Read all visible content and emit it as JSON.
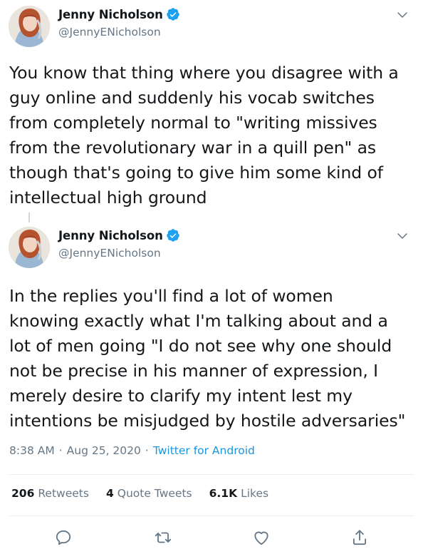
{
  "tweets": [
    {
      "author": {
        "name": "Jenny Nicholson",
        "handle": "@JennyENicholson",
        "verified": true
      },
      "text": "You know that thing where you disagree with a\nguy online and suddenly his vocab switches\nfrom completely normal to \"writing missives\nfrom the revolutionary war in a quill pen\" as\nthough that's going to give him some kind of\nintellectual high ground"
    },
    {
      "author": {
        "name": "Jenny Nicholson",
        "handle": "@JennyENicholson",
        "verified": true
      },
      "text": "In the replies you'll find a lot of women\nknowing exactly what I'm talking about and a\nlot of men going \"I do not see why one should\nnot be precise in his manner of expression, I\nmerely desire to clarify my intent lest my\nintentions be misjudged by hostile adversaries\"",
      "time": "8:38 AM",
      "date": "Aug 25, 2020",
      "separator": "·",
      "source": "Twitter for Android",
      "stats": {
        "retweets": {
          "count": "206",
          "label": "Retweets"
        },
        "quote_tweets": {
          "count": "4",
          "label": "Quote Tweets"
        },
        "likes": {
          "count": "6.1K",
          "label": "Likes"
        }
      }
    }
  ],
  "icons": {
    "verified": "verified-badge-icon",
    "more": "chevron-down-icon",
    "reply": "reply-icon",
    "retweet": "retweet-icon",
    "like": "heart-icon",
    "share": "share-icon"
  },
  "colors": {
    "text": "#14171a",
    "secondary": "#657786",
    "link": "#1b95e0",
    "verified": "#1da1f2",
    "divider": "#e6ecf0"
  }
}
